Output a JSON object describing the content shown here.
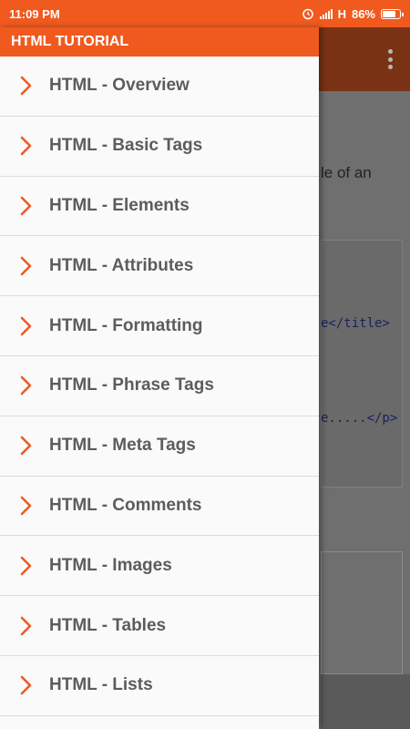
{
  "status": {
    "time": "11:09 PM",
    "network": "H",
    "battery": "86%"
  },
  "drawer": {
    "title": "HTML TUTORIAL",
    "accent": "#f05a1f",
    "items": [
      {
        "label": "HTML - Overview"
      },
      {
        "label": "HTML - Basic Tags"
      },
      {
        "label": "HTML - Elements"
      },
      {
        "label": "HTML - Attributes"
      },
      {
        "label": "HTML - Formatting"
      },
      {
        "label": "HTML - Phrase Tags"
      },
      {
        "label": "HTML - Meta Tags"
      },
      {
        "label": "HTML - Comments"
      },
      {
        "label": "HTML - Images"
      },
      {
        "label": "HTML - Tables"
      },
      {
        "label": "HTML - Lists"
      }
    ]
  },
  "background": {
    "text_fragment": "le of an",
    "code_line_1": "e</title>",
    "code_line_2": "e.....</p>"
  }
}
